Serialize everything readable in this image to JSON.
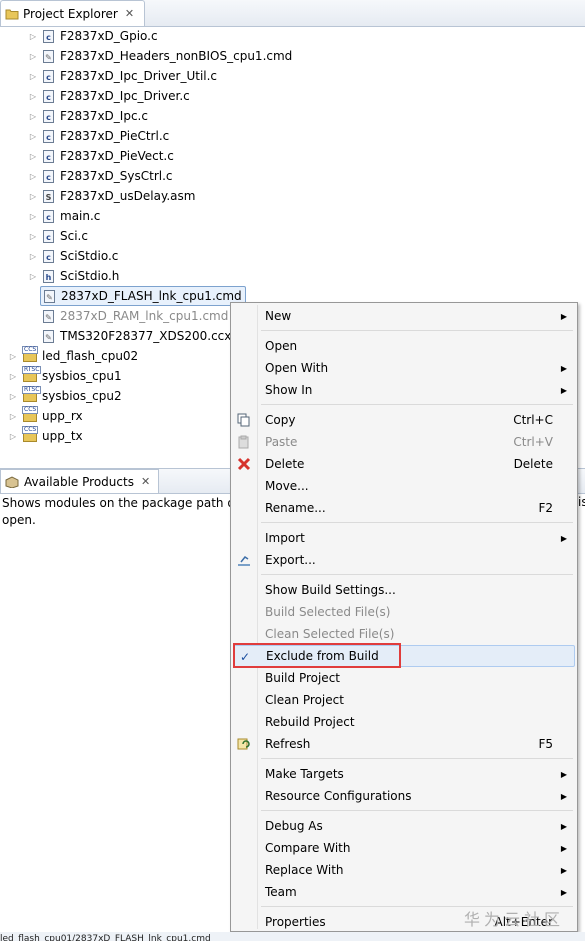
{
  "project_explorer": {
    "tab_title": "Project Explorer",
    "files": [
      {
        "name": "F2837xD_Gpio.c",
        "type": "c"
      },
      {
        "name": "F2837xD_Headers_nonBIOS_cpu1.cmd",
        "type": "cmd"
      },
      {
        "name": "F2837xD_Ipc_Driver_Util.c",
        "type": "c"
      },
      {
        "name": "F2837xD_Ipc_Driver.c",
        "type": "c"
      },
      {
        "name": "F2837xD_Ipc.c",
        "type": "c"
      },
      {
        "name": "F2837xD_PieCtrl.c",
        "type": "c"
      },
      {
        "name": "F2837xD_PieVect.c",
        "type": "c"
      },
      {
        "name": "F2837xD_SysCtrl.c",
        "type": "c"
      },
      {
        "name": "F2837xD_usDelay.asm",
        "type": "asm"
      },
      {
        "name": "main.c",
        "type": "c"
      },
      {
        "name": "Sci.c",
        "type": "c"
      },
      {
        "name": "SciStdio.c",
        "type": "c"
      },
      {
        "name": "SciStdio.h",
        "type": "h"
      }
    ],
    "linker_files": [
      {
        "name": "2837xD_FLASH_lnk_cpu1.cmd",
        "state": "selected"
      },
      {
        "name": "2837xD_RAM_lnk_cpu1.cmd",
        "state": "excluded"
      },
      {
        "name": "TMS320F28377_XDS200.ccxml",
        "state": "normal"
      }
    ],
    "projects": [
      {
        "name": "led_flash_cpu02",
        "badge": "CCS"
      },
      {
        "name": "sysbios_cpu1",
        "badge": "RTSC"
      },
      {
        "name": "sysbios_cpu2",
        "badge": "RTSC"
      },
      {
        "name": "upp_rx",
        "badge": "CCS"
      },
      {
        "name": "upp_tx",
        "badge": "CCS"
      }
    ]
  },
  "available_products": {
    "tab_title": "Available Products",
    "description_line1": "Shows modules on the package path o",
    "description_line2": "open.",
    "description_tail": "is"
  },
  "context_menu": {
    "items": [
      {
        "label": "New",
        "submenu": true
      },
      {
        "separator": true
      },
      {
        "label": "Open"
      },
      {
        "label": "Open With",
        "submenu": true
      },
      {
        "label": "Show In",
        "submenu": true
      },
      {
        "separator": true
      },
      {
        "label": "Copy",
        "shortcut": "Ctrl+C",
        "icon": "copy-icon"
      },
      {
        "label": "Paste",
        "shortcut": "Ctrl+V",
        "icon": "paste-icon",
        "disabled": true
      },
      {
        "label": "Delete",
        "shortcut": "Delete",
        "icon": "delete-icon"
      },
      {
        "label": "Move..."
      },
      {
        "label": "Rename...",
        "shortcut": "F2"
      },
      {
        "separator": true
      },
      {
        "label": "Import",
        "submenu": true
      },
      {
        "label": "Export...",
        "icon": "export-icon"
      },
      {
        "separator": true
      },
      {
        "label": "Show Build Settings..."
      },
      {
        "label": "Build Selected File(s)",
        "disabled": true
      },
      {
        "label": "Clean Selected File(s)",
        "disabled": true
      },
      {
        "label": "Exclude from Build",
        "checked": true,
        "hover": true
      },
      {
        "label": "Build Project"
      },
      {
        "label": "Clean Project"
      },
      {
        "label": "Rebuild Project"
      },
      {
        "label": "Refresh",
        "shortcut": "F5",
        "icon": "refresh-icon"
      },
      {
        "separator": true
      },
      {
        "label": "Make Targets",
        "submenu": true
      },
      {
        "label": "Resource Configurations",
        "submenu": true
      },
      {
        "separator": true
      },
      {
        "label": "Debug As",
        "submenu": true
      },
      {
        "label": "Compare With",
        "submenu": true
      },
      {
        "label": "Replace With",
        "submenu": true
      },
      {
        "label": "Team",
        "submenu": true
      },
      {
        "separator": true
      },
      {
        "label": "Properties",
        "shortcut": "Alt+Enter"
      }
    ]
  },
  "watermark": "华为云社区",
  "status_bar": "led_flash_cpu01/2837xD_FLASH_lnk_cpu1.cmd",
  "colors": {
    "highlight_box": "#e03c3c",
    "selection": "#e8f1fc",
    "menu_bg": "#f5f5f5"
  }
}
